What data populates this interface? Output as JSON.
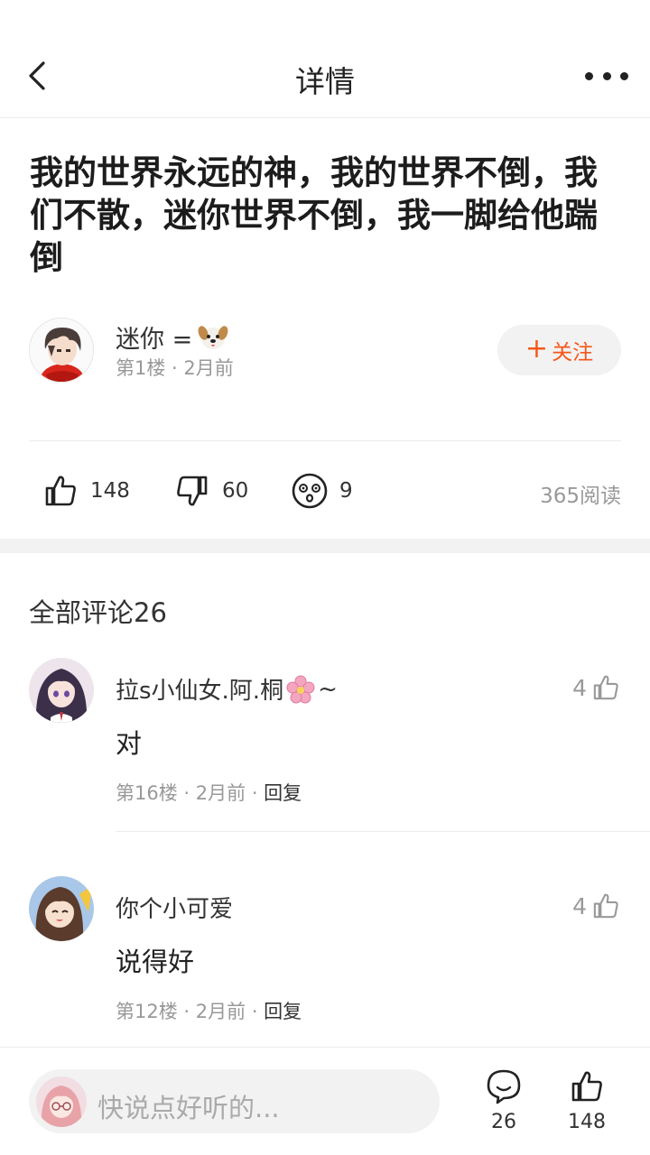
{
  "header": {
    "title": "详情"
  },
  "post": {
    "title": "我的世界永远的神，我的世界不倒，我们不散，迷你世界不倒，我一脚给他踹倒",
    "author": {
      "name": "迷你 =",
      "meta": "第1楼 · 2月前",
      "avatar_icon": "anime-boy-avatar",
      "name_emoji": "dog-face-emoji"
    },
    "follow_label": "关注"
  },
  "actions": {
    "likes": "148",
    "dislikes": "60",
    "reactions": "9",
    "reads": "365阅读"
  },
  "comments": {
    "heading": "全部评论26",
    "items": [
      {
        "name": "拉s小仙女.阿.桐",
        "name_suffix": "~",
        "text": "对",
        "floor": "第16楼",
        "time": "2月前",
        "reply_label": "回复",
        "likes": "4"
      },
      {
        "name": "你个小可爱",
        "name_suffix": "",
        "text": "说得好",
        "floor": "第12楼",
        "time": "2月前",
        "reply_label": "回复",
        "likes": "4"
      }
    ]
  },
  "bottom_bar": {
    "placeholder": "快说点好听的...",
    "comment_count": "26",
    "like_count": "148"
  },
  "colors": {
    "accent": "#f5571b",
    "muted": "#999999",
    "band": "#f2f2f2"
  }
}
